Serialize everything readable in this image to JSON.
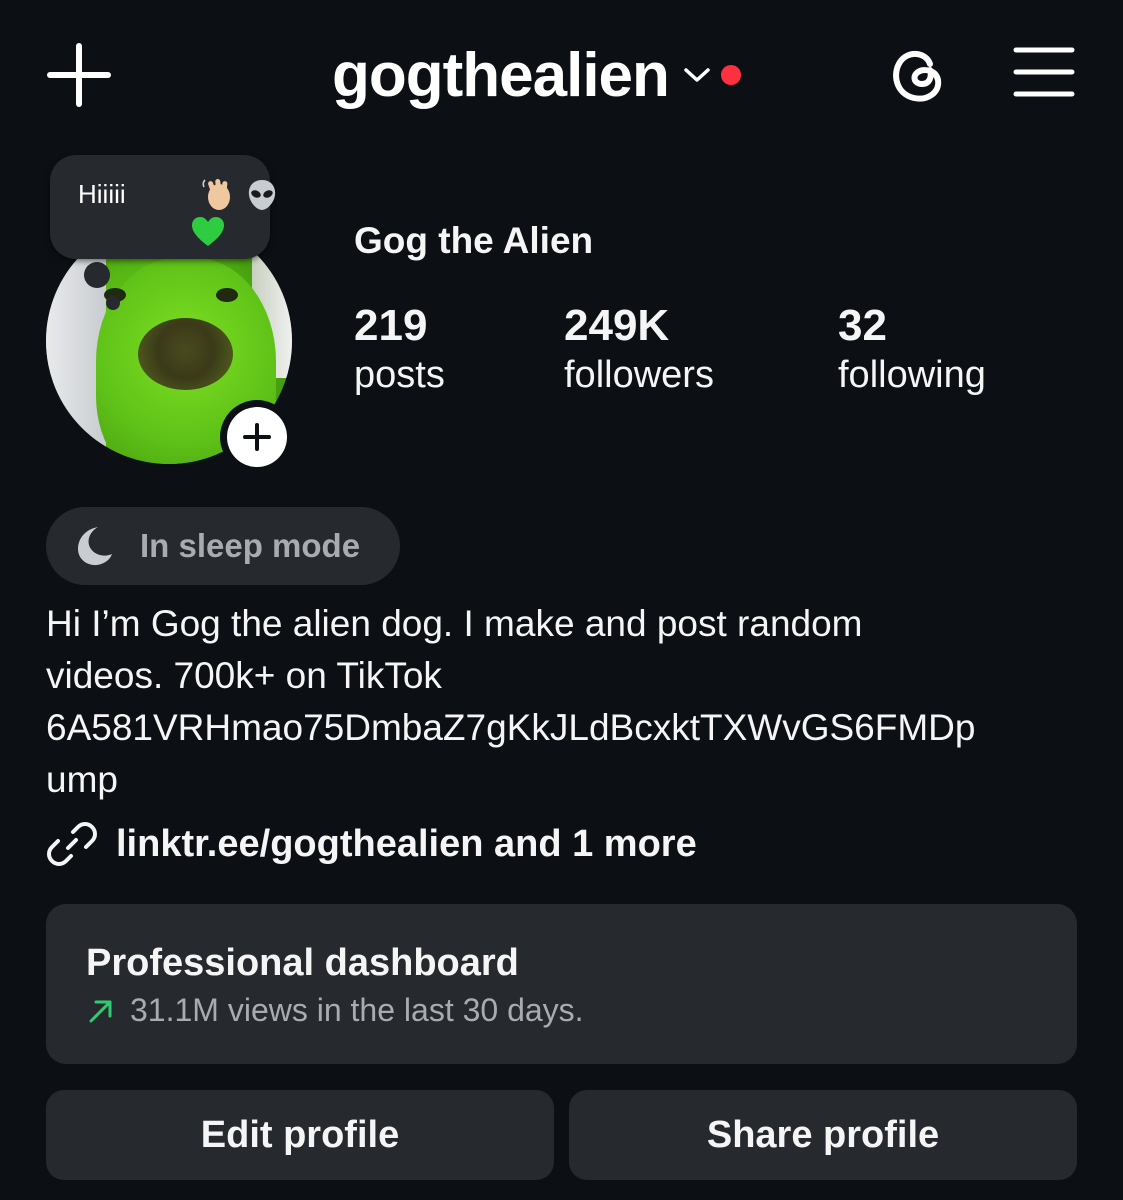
{
  "header": {
    "username": "gogthealien",
    "create_icon": "plus-icon",
    "threads_icon": "threads-icon",
    "menu_icon": "hamburger-menu-icon",
    "notification_dot_color": "#ff3040"
  },
  "note": {
    "text": "Hiiiii",
    "emojis": [
      "👋",
      "👽",
      "💚"
    ]
  },
  "profile": {
    "display_name": "Gog the Alien",
    "stats": [
      {
        "value": "219",
        "label": "posts"
      },
      {
        "value": "249K",
        "label": "followers"
      },
      {
        "value": "32",
        "label": "following"
      }
    ]
  },
  "status": {
    "icon": "moon-icon",
    "text": "In sleep mode"
  },
  "bio": {
    "lines": [
      "Hi I’m Gog the alien dog. I make and post random",
      "videos. 700k+ on TikTok",
      "6A581VRHmao75DmbaZ7gKkJLdBcxktTXWvGS6FMDp",
      "ump"
    ]
  },
  "link": {
    "icon": "link-icon",
    "text": "linktr.ee/gogthealien and 1 more"
  },
  "dashboard": {
    "title": "Professional dashboard",
    "subtitle": "31.1M views in the last 30 days.",
    "trend_color": "#2ecc71"
  },
  "actions": {
    "edit_label": "Edit profile",
    "share_label": "Share profile"
  },
  "colors": {
    "background": "#0c1014",
    "surface": "#262a2f",
    "text": "#f5f5f5",
    "muted": "#a8abb0"
  }
}
